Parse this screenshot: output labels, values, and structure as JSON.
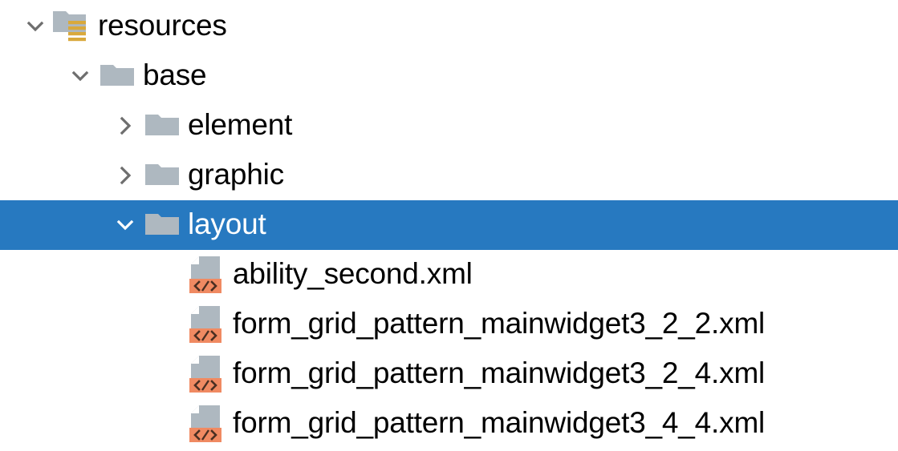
{
  "tree": {
    "selection_color": "#2779c0",
    "folder_color": "#aeb8c0",
    "resource_stripe_color": "#d9a93c",
    "xml_badge_color": "#f08a62",
    "document_color": "#aeb8c0",
    "chevron_color": "#6e6e6e",
    "nodes": [
      {
        "label": "resources",
        "depth": 0,
        "type": "folder",
        "icon": "folder-resources-icon",
        "twisty": "chevron-down-icon",
        "expanded": true,
        "selected": false
      },
      {
        "label": "base",
        "depth": 1,
        "type": "folder",
        "icon": "folder-icon",
        "twisty": "chevron-down-icon",
        "expanded": true,
        "selected": false
      },
      {
        "label": "element",
        "depth": 2,
        "type": "folder",
        "icon": "folder-icon",
        "twisty": "chevron-right-icon",
        "expanded": false,
        "selected": false
      },
      {
        "label": "graphic",
        "depth": 2,
        "type": "folder",
        "icon": "folder-icon",
        "twisty": "chevron-right-icon",
        "expanded": false,
        "selected": false
      },
      {
        "label": "layout",
        "depth": 2,
        "type": "folder",
        "icon": "folder-icon",
        "twisty": "chevron-down-icon",
        "expanded": true,
        "selected": true
      },
      {
        "label": "ability_second.xml",
        "depth": 3,
        "type": "file",
        "icon": "xml-file-icon",
        "twisty": "none",
        "expanded": false,
        "selected": false
      },
      {
        "label": "form_grid_pattern_mainwidget3_2_2.xml",
        "depth": 3,
        "type": "file",
        "icon": "xml-file-icon",
        "twisty": "none",
        "expanded": false,
        "selected": false
      },
      {
        "label": "form_grid_pattern_mainwidget3_2_4.xml",
        "depth": 3,
        "type": "file",
        "icon": "xml-file-icon",
        "twisty": "none",
        "expanded": false,
        "selected": false
      },
      {
        "label": "form_grid_pattern_mainwidget3_4_4.xml",
        "depth": 3,
        "type": "file",
        "icon": "xml-file-icon",
        "twisty": "none",
        "expanded": false,
        "selected": false
      }
    ]
  }
}
